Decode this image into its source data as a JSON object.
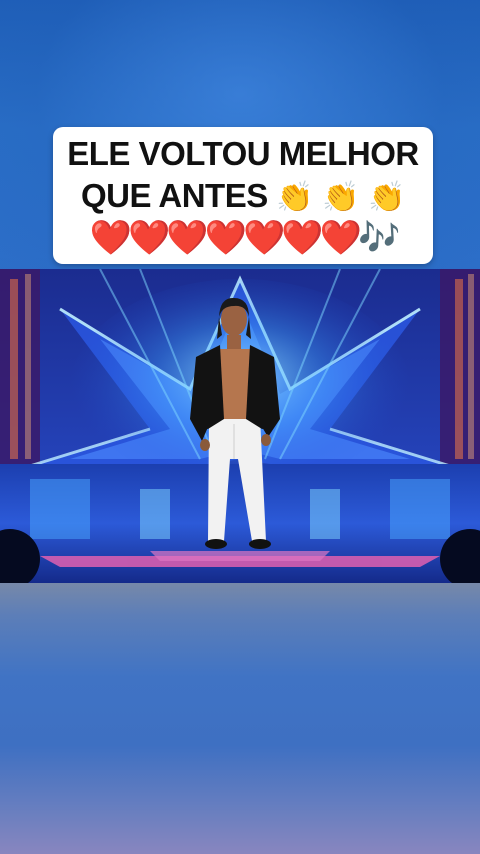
{
  "caption": {
    "line1": "ELE VOLTOU MELHOR",
    "line2_text": "QUE ANTES",
    "line2_emojis": "👏 👏 👏",
    "line3_emojis": "❤️❤️❤️❤️❤️❤️❤️🎶"
  },
  "video": {
    "scene": "stage-performance"
  },
  "colors": {
    "caption_bg": "#ffffff",
    "caption_text": "#111111",
    "heart": "#e0201e",
    "stage_blue": "#1e4fd8"
  }
}
